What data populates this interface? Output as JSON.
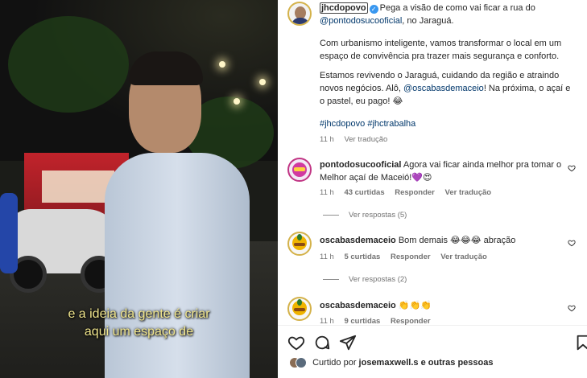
{
  "video": {
    "subtitle_line1": "e a ideia da gente é criar",
    "subtitle_line2": "aqui um espaço de"
  },
  "post": {
    "username": "jhcdopovo",
    "caption_lead": "Pega a visão de como vai ficar a rua do",
    "mention": "@pontodosucooficial",
    "caption_tail": ", no Jaraguá.",
    "paragraph2": "Com urbanismo inteligente, vamos transformar o local em um espaço de convivência pra trazer mais segurança e conforto.",
    "paragraph3_a": "Estamos revivendo o Jaraguá, cuidando da região e atraindo novos negócios. Alô,",
    "paragraph3_mention": "@oscabasdemaceio",
    "paragraph3_b": "! Na próxima, o açaí e o pastel, eu pago! 😂",
    "hashtags": "#jhcdopovo #jhctrabalha",
    "time": "11 h",
    "see_translation": "Ver tradução"
  },
  "comments": [
    {
      "username": "pontodosucooficial",
      "text": "Agora vai ficar ainda melhor pra tomar o Melhor açaí de Maceió!💜😍",
      "time": "11 h",
      "likes": "43 curtidas",
      "reply": "Responder",
      "translate": "Ver tradução",
      "view_replies": "Ver respostas (5)"
    },
    {
      "username": "oscabasdemaceio",
      "text": "Bom demais 😂😂😂 abração",
      "time": "11 h",
      "likes": "5 curtidas",
      "reply": "Responder",
      "translate": "Ver tradução",
      "view_replies": "Ver respostas (2)"
    },
    {
      "username": "oscabasdemaceio",
      "text": "👏👏👏",
      "time": "11 h",
      "likes": "9 curtidas",
      "reply": "Responder"
    }
  ],
  "footer": {
    "liked_by_prefix": "Curtido por",
    "liked_by_user": "josemaxwell.s",
    "liked_by_suffix": "e outras pessoas"
  },
  "icons": [
    "heart-icon",
    "comment-icon",
    "share-icon",
    "bookmark-icon",
    "verified-icon"
  ]
}
